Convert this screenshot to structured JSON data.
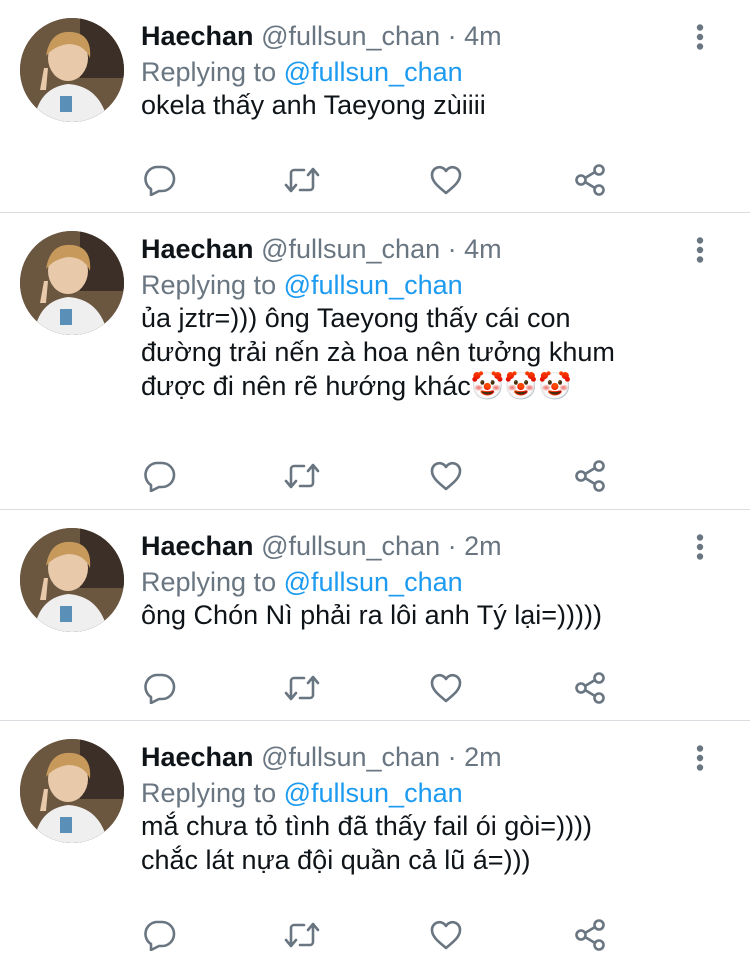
{
  "tweets": [
    {
      "name": "Haechan",
      "handle": "@fullsun_chan",
      "dot": "·",
      "time": "4m",
      "reply_prefix": "Replying to ",
      "reply_to": "@fullsun_chan",
      "text": "okela thấy anh Taeyong zùiiii"
    },
    {
      "name": "Haechan",
      "handle": "@fullsun_chan",
      "dot": "·",
      "time": "4m",
      "reply_prefix": "Replying to ",
      "reply_to": "@fullsun_chan",
      "text": "ủa jztr=))) ông Taeyong thấy cái con\nđường trải nến zà hoa nên tưởng khum\nđược đi nên rẽ hướng khác🤡🤡🤡"
    },
    {
      "name": "Haechan",
      "handle": "@fullsun_chan",
      "dot": "·",
      "time": "2m",
      "reply_prefix": "Replying to ",
      "reply_to": "@fullsun_chan",
      "text": "ông Chón Nì phải ra lôi anh Tý lại=)))))"
    },
    {
      "name": "Haechan",
      "handle": "@fullsun_chan",
      "dot": "·",
      "time": "2m",
      "reply_prefix": "Replying to ",
      "reply_to": "@fullsun_chan",
      "text": "mắ chưa tỏ tình đã thấy fail ói gòi=))))\nchắc lát nựa đội quần cả lũ á=)))"
    }
  ],
  "icons": {
    "reply": "reply-icon",
    "retweet": "retweet-icon",
    "like": "heart-icon",
    "share": "share-icon",
    "more": "more-vertical-icon"
  },
  "colors": {
    "text": "#0f1419",
    "secondary": "#697681",
    "mention": "#1d9bf0",
    "divider": "#d9dde2"
  }
}
